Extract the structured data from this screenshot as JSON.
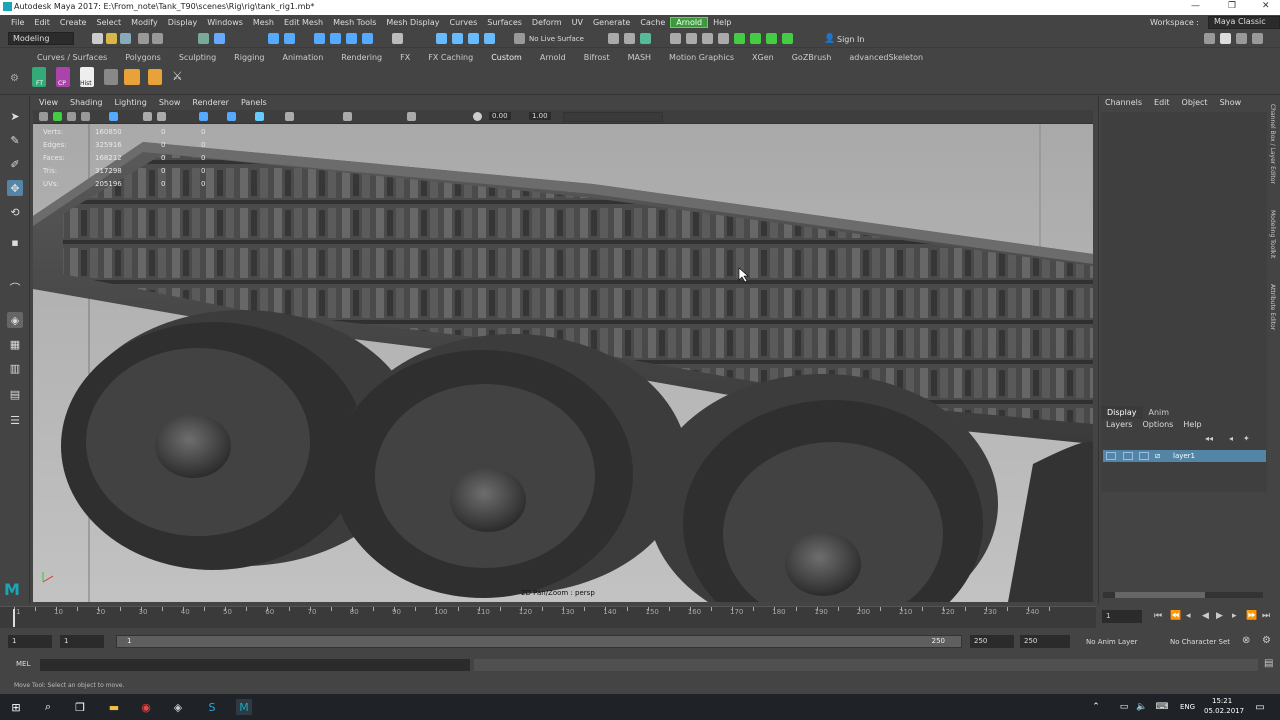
{
  "window": {
    "title": "Autodesk Maya 2017: E:\\From_note\\Tank_T90\\scenes\\Rig\\rig\\tank_rig1.mb*"
  },
  "menu": {
    "items": [
      "File",
      "Edit",
      "Create",
      "Select",
      "Modify",
      "Display",
      "Windows",
      "Mesh",
      "Edit Mesh",
      "Mesh Tools",
      "Mesh Display",
      "Curves",
      "Surfaces",
      "Deform",
      "UV",
      "Generate",
      "Cache",
      "Arnold",
      "Help"
    ],
    "workspace_label": "Workspace :",
    "workspace_value": "Maya Classic"
  },
  "statusline": {
    "mode": "Modeling",
    "live_surface": "No Live Surface",
    "sign_in": "Sign In"
  },
  "shelf": {
    "tabs": [
      "Curves / Surfaces",
      "Polygons",
      "Sculpting",
      "Rigging",
      "Animation",
      "Rendering",
      "FX",
      "FX Caching",
      "Custom",
      "Arnold",
      "Bifrost",
      "MASH",
      "Motion Graphics",
      "XGen",
      "GoZBrush",
      "advancedSkeleton"
    ],
    "active_tab": "Custom",
    "buttons": [
      "FT",
      "CP",
      "Hist"
    ]
  },
  "viewport": {
    "menu": [
      "View",
      "Shading",
      "Lighting",
      "Show",
      "Renderer",
      "Panels"
    ],
    "field_a": "0.00",
    "field_b": "1.00",
    "hud": [
      {
        "k": "Verts:",
        "v": "160850",
        "a": "0",
        "b": "0"
      },
      {
        "k": "Edges:",
        "v": "325916",
        "a": "0",
        "b": "0"
      },
      {
        "k": "Faces:",
        "v": "168212",
        "a": "0",
        "b": "0"
      },
      {
        "k": "Tris:",
        "v": "317298",
        "a": "0",
        "b": "0"
      },
      {
        "k": "UVs:",
        "v": "205196",
        "a": "0",
        "b": "0"
      }
    ],
    "camera_label": "2D Pan/Zoom : persp"
  },
  "channel_box": {
    "menu": [
      "Channels",
      "Edit",
      "Object",
      "Show"
    ],
    "side_tabs": [
      "Channel Box / Layer Editor",
      "Modeling Toolkit",
      "Attribute Editor"
    ]
  },
  "layer_editor": {
    "tabs": [
      "Display",
      "Anim"
    ],
    "active_tab": "Display",
    "menu": [
      "Layers",
      "Options",
      "Help"
    ],
    "layers": [
      {
        "v": "V",
        "p": "P",
        "name": "layer1"
      }
    ]
  },
  "timeline": {
    "ticks": [
      1,
      10,
      20,
      30,
      40,
      50,
      60,
      70,
      80,
      90,
      100,
      110,
      120,
      130,
      140,
      150,
      160,
      170,
      180,
      190,
      200,
      210,
      220,
      230,
      240
    ],
    "current_frame": "1"
  },
  "range": {
    "start": "1",
    "start_inner": "1",
    "range_box": "1",
    "range_end": "250",
    "end_inner": "250",
    "end": "250",
    "anim_layer": "No Anim Layer",
    "char_set": "No Character Set"
  },
  "mel": {
    "label": "MEL"
  },
  "help_line": "Move Tool: Select an object to move.",
  "taskbar": {
    "lang": "ENG",
    "time": "15:21",
    "date": "05.02.2017"
  },
  "colors": {
    "accent": "#5285a6",
    "arnold": "#3d9a3a",
    "viewport_bg": "#b3b3b3"
  }
}
